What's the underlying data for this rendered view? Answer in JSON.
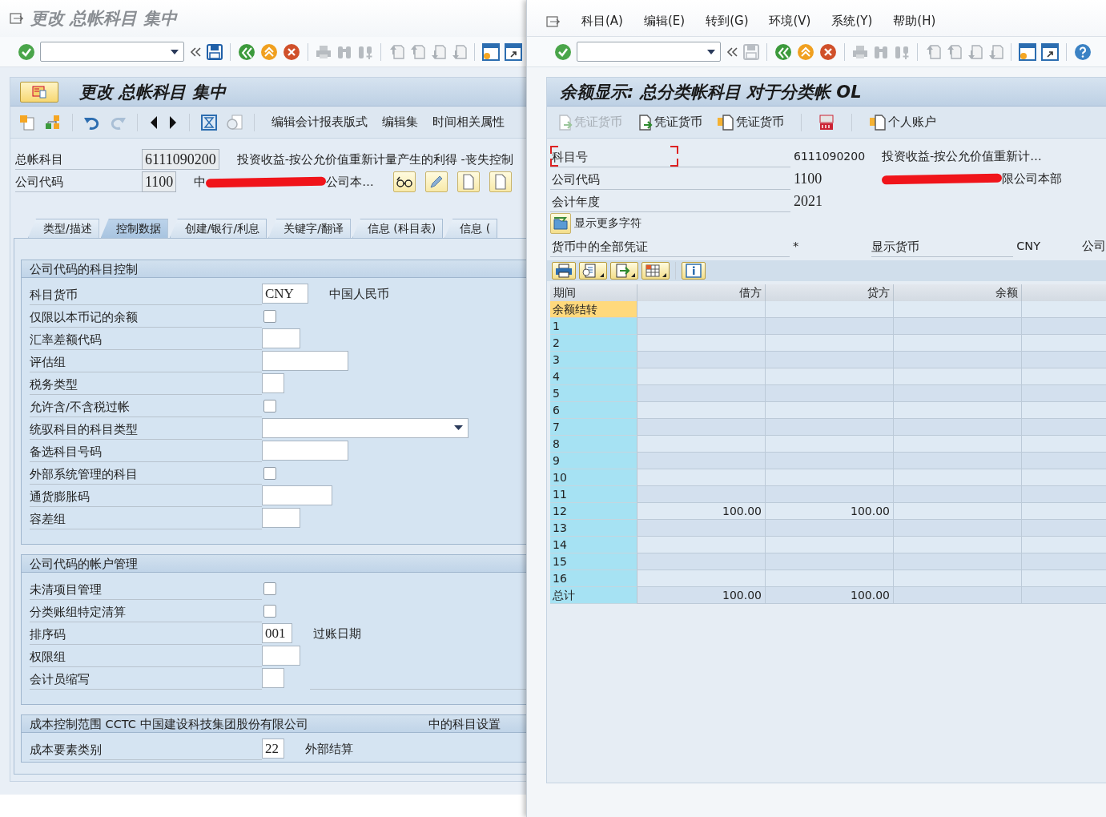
{
  "left_window": {
    "title": "更改 总帐科目 集中",
    "standard_toolbar": {
      "save_enabled": true
    },
    "screen_title": "更改 总帐科目 集中",
    "app_toolbar": [
      "编辑会计报表版式",
      "编辑集",
      "时间相关属性"
    ],
    "header_fields": [
      {
        "label": "总帐科目",
        "value": "6111090200",
        "description": "投资收益-按公允价值重新计量产生的利得 -丧失控制"
      },
      {
        "label": "公司代码",
        "value": "1100",
        "description": "中",
        "description_end": "公司本…",
        "redacted": true
      }
    ],
    "tabs": [
      {
        "label": "类型/描述",
        "selected": false
      },
      {
        "label": "控制数据",
        "selected": true
      },
      {
        "label": "创建/银行/利息",
        "selected": false
      },
      {
        "label": "关键字/翻译",
        "selected": false
      },
      {
        "label": "信息 (科目表)",
        "selected": false
      },
      {
        "label": "信息 (",
        "selected": false
      }
    ],
    "groups": [
      {
        "title": "公司代码的科目控制",
        "rows": [
          {
            "kind": "field",
            "label": "科目货币",
            "value": "CNY",
            "note": "中国人民币"
          },
          {
            "kind": "checkbox",
            "label": "仅限以本币记的余额",
            "checked": false
          },
          {
            "kind": "field",
            "label": "汇率差额代码"
          },
          {
            "kind": "field",
            "label": "评估组"
          },
          {
            "kind": "field",
            "label": "税务类型"
          },
          {
            "kind": "checkbox",
            "label": "允许含/不含税过帐",
            "checked": false
          },
          {
            "kind": "dropdown",
            "label": "统驭科目的科目类型"
          },
          {
            "kind": "field",
            "label": "备选科目号码"
          },
          {
            "kind": "checkbox",
            "label": "外部系统管理的科目",
            "checked": false
          },
          {
            "kind": "field",
            "label": "通货膨胀码"
          },
          {
            "kind": "field",
            "label": "容差组"
          }
        ]
      },
      {
        "title": "公司代码的帐户管理",
        "rows": [
          {
            "kind": "checkbox",
            "label": "未清项目管理",
            "checked": false
          },
          {
            "kind": "checkbox",
            "label": "分类账组特定清算",
            "checked": false
          },
          {
            "kind": "field",
            "label": "排序码",
            "value": "001",
            "note": "过账日期"
          },
          {
            "kind": "field",
            "label": "权限组"
          },
          {
            "kind": "field",
            "label": "会计员缩写"
          }
        ]
      },
      {
        "title": "成本控制范围 CCTC 中国建设科技集团股份有限公司",
        "title_end": "中的科目设置",
        "rows": [
          {
            "kind": "field",
            "label": "成本要素类别",
            "value": "22",
            "note": "外部结算"
          }
        ]
      }
    ]
  },
  "right_window": {
    "menu": [
      "科目(A)",
      "编辑(E)",
      "转到(G)",
      "环境(V)",
      "系统(Y)",
      "帮助(H)"
    ],
    "standard_toolbar": {
      "save_enabled": false
    },
    "title": "余额显示: 总分类帐科目 对于分类帐 OL",
    "app_toolbar": [
      {
        "kind": "doc-back",
        "label": "凭证货币",
        "disabled": true
      },
      {
        "kind": "doc-forward",
        "label": "凭证货币",
        "disabled": false
      },
      {
        "kind": "doc-tree",
        "label": "凭证货币",
        "disabled": false
      },
      {
        "kind": "currency",
        "disabled": false
      },
      {
        "kind": "doc-tree",
        "label": "个人账户",
        "disabled": false
      }
    ],
    "fields": [
      {
        "label": "科目号",
        "value": "6111090200",
        "description": "投资收益-按公允价值重新计…",
        "focused": true
      },
      {
        "label": "公司代码",
        "value": "1100",
        "description": "限公司本部",
        "focused": false,
        "redacted": true
      },
      {
        "label": "会计年度",
        "value": "2021",
        "focused": false
      }
    ],
    "more_button": "显示更多字符",
    "currency_row": {
      "label": "货币中的全部凭证",
      "value": "*",
      "label_2": "显示货币",
      "value_2": "CNY",
      "label_3": "公司"
    },
    "table": {
      "columns": [
        "期间",
        "借方",
        "贷方",
        "余额"
      ],
      "rows": [
        {
          "period": "余额结转",
          "selected": true
        },
        {
          "period": "1",
          "selected": false
        },
        {
          "period": "2",
          "selected": false
        },
        {
          "period": "3",
          "selected": false
        },
        {
          "period": "4",
          "selected": false
        },
        {
          "period": "5",
          "selected": false
        },
        {
          "period": "6",
          "selected": false
        },
        {
          "period": "7",
          "selected": false
        },
        {
          "period": "8",
          "selected": false
        },
        {
          "period": "9",
          "selected": false
        },
        {
          "period": "10",
          "selected": false
        },
        {
          "period": "11",
          "selected": false
        },
        {
          "period": "12",
          "debit": "100.00",
          "credit": "100.00",
          "selected": false
        },
        {
          "period": "13",
          "selected": false
        },
        {
          "period": "14",
          "selected": false
        },
        {
          "period": "15",
          "selected": false
        },
        {
          "period": "16",
          "selected": false
        },
        {
          "period": "总计",
          "debit": "100.00",
          "credit": "100.00",
          "selected": false
        }
      ]
    }
  }
}
